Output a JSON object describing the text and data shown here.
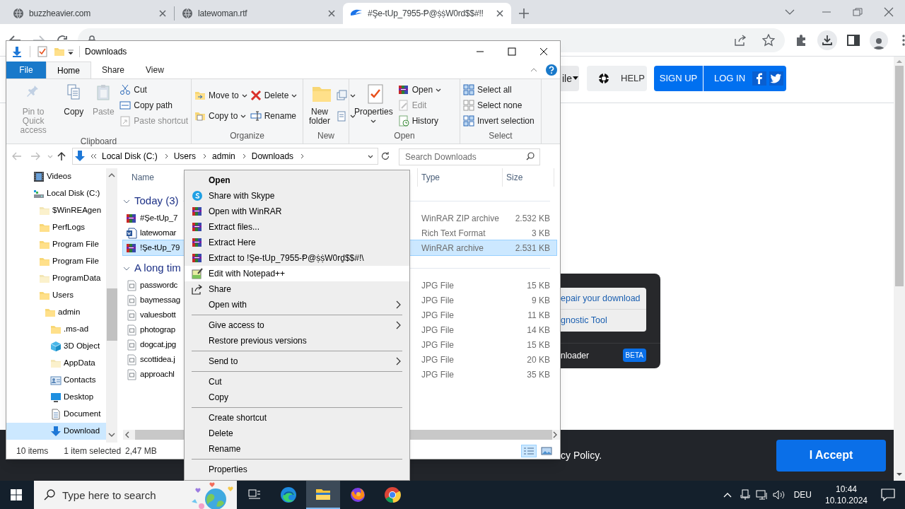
{
  "browser": {
    "tabs": [
      {
        "title": "buzzheavier.com",
        "selected": false
      },
      {
        "title": "latewoman.rtf",
        "selected": false
      },
      {
        "title": "#Şe-tUp_7955-Ᵽ@ṩṩW0rd$$#!!",
        "selected": true
      }
    ],
    "header_buttons": [
      {
        "label": "ile",
        "kind": "menu"
      },
      {
        "label": "HELP",
        "kind": "help"
      }
    ],
    "auth": {
      "sign_up": "SIGN UP",
      "log_in": "LOG IN"
    },
    "download_panel": {
      "links": [
        "epair your download",
        "gnostic Tool"
      ],
      "footer": "nloader",
      "badge": "BETA"
    },
    "cookie_bar": {
      "text": "cy Policy.",
      "button": "I Accept"
    }
  },
  "explorer": {
    "title": "Downloads",
    "ribbon_tabs": [
      {
        "label": "File",
        "selected": false,
        "kind": "file"
      },
      {
        "label": "Home",
        "selected": true,
        "kind": "tab"
      },
      {
        "label": "Share",
        "selected": false,
        "kind": "tab"
      },
      {
        "label": "View",
        "selected": false,
        "kind": "tab"
      }
    ],
    "ribbon_groups": [
      {
        "label": "Clipboard",
        "columns": [
          [
            {
              "label": "Pin to Quick access",
              "kind": "large",
              "disabled": true,
              "dropdown": false
            }
          ],
          [
            {
              "label": "Copy",
              "kind": "large",
              "disabled": false,
              "dropdown": false
            }
          ],
          [
            {
              "label": "Paste",
              "kind": "large",
              "disabled": true,
              "dropdown": false
            }
          ],
          [
            {
              "label": "Cut",
              "kind": "small",
              "disabled": false,
              "dropdown": false
            },
            {
              "label": "Copy path",
              "kind": "small",
              "disabled": false,
              "dropdown": false
            },
            {
              "label": "Paste shortcut",
              "kind": "small",
              "disabled": true,
              "dropdown": false
            }
          ]
        ]
      },
      {
        "label": "Organize",
        "columns": [
          [
            {
              "label": "Move to",
              "kind": "small",
              "disabled": false,
              "dropdown": true
            },
            {
              "label": "Copy to",
              "kind": "small",
              "disabled": false,
              "dropdown": true
            }
          ],
          [
            {
              "label": "Delete",
              "kind": "small",
              "disabled": false,
              "dropdown": true
            },
            {
              "label": "Rename",
              "kind": "small",
              "disabled": false,
              "dropdown": false
            }
          ]
        ]
      },
      {
        "label": "New",
        "columns": [
          [
            {
              "label": "New folder",
              "kind": "large",
              "disabled": false,
              "dropdown": false
            }
          ],
          [
            {
              "kind": "small",
              "disabled": false,
              "dropdown": true
            },
            {
              "kind": "small",
              "disabled": false,
              "dropdown": true
            }
          ]
        ]
      },
      {
        "label": "Open",
        "columns": [
          [
            {
              "label": "Properties",
              "kind": "large",
              "disabled": false,
              "dropdown": true
            }
          ],
          [
            {
              "label": "Open",
              "kind": "small",
              "disabled": false,
              "dropdown": true
            },
            {
              "label": "Edit",
              "kind": "small",
              "disabled": true,
              "dropdown": false
            },
            {
              "label": "History",
              "kind": "small",
              "disabled": false,
              "dropdown": false
            }
          ]
        ]
      },
      {
        "label": "Select",
        "columns": [
          [
            {
              "label": "Select all",
              "kind": "small",
              "disabled": false,
              "dropdown": false
            },
            {
              "label": "Select none",
              "kind": "small",
              "disabled": false,
              "dropdown": false
            },
            {
              "label": "Invert selection",
              "kind": "small",
              "disabled": false,
              "dropdown": false
            }
          ]
        ]
      }
    ],
    "path": [
      "Local Disk (C:)",
      "Users",
      "admin",
      "Downloads"
    ],
    "search_placeholder": "Search Downloads",
    "nav_tree": [
      {
        "label": "Videos",
        "selected": false
      },
      {
        "label": "Local Disk (C:)",
        "selected": false,
        "children": [
          {
            "label": "$WinREAgen",
            "selected": false
          },
          {
            "label": "PerfLogs",
            "selected": false
          },
          {
            "label": "Program File",
            "selected": false
          },
          {
            "label": "Program File",
            "selected": false
          },
          {
            "label": "ProgramData",
            "selected": false
          },
          {
            "label": "Users",
            "selected": false,
            "children": [
              {
                "label": "admin",
                "selected": false,
                "children": [
                  {
                    "label": ".ms-ad",
                    "selected": false
                  },
                  {
                    "label": "3D Object",
                    "selected": false
                  },
                  {
                    "label": "AppData",
                    "selected": false
                  },
                  {
                    "label": "Contacts",
                    "selected": false
                  },
                  {
                    "label": "Desktop",
                    "selected": false
                  },
                  {
                    "label": "Document",
                    "selected": false
                  },
                  {
                    "label": "Download",
                    "selected": true
                  }
                ]
              }
            ]
          }
        ]
      }
    ],
    "columns": [
      "Name",
      "Type",
      "Size"
    ],
    "file_groups": [
      {
        "label": "Today (3)",
        "expanded": true,
        "files": [
          {
            "name": "#Şe-tUp_7",
            "type": "WinRAR ZIP archive",
            "size": "2.532 KB",
            "kind": "archive",
            "selected": false
          },
          {
            "name": "latewomar",
            "type": "Rich Text Format",
            "size": "3 KB",
            "kind": "document",
            "selected": false
          },
          {
            "name": "!Şe-tUp_79",
            "type": "WinRAR archive",
            "size": "2.531 KB",
            "kind": "archive",
            "selected": true
          }
        ]
      },
      {
        "label": "A long tim",
        "expanded": true,
        "files": [
          {
            "name": "passwordc",
            "type": "JPG File",
            "size": "15 KB",
            "kind": "image",
            "selected": false
          },
          {
            "name": "baymessag",
            "type": "JPG File",
            "size": "9 KB",
            "kind": "image",
            "selected": false
          },
          {
            "name": "valuesbott",
            "type": "JPG File",
            "size": "11 KB",
            "kind": "image",
            "selected": false
          },
          {
            "name": "photograp",
            "type": "JPG File",
            "size": "14 KB",
            "kind": "image",
            "selected": false
          },
          {
            "name": "dogcat.jpg",
            "type": "JPG File",
            "size": "15 KB",
            "kind": "image",
            "selected": false
          },
          {
            "name": "scottidea.j",
            "type": "JPG File",
            "size": "20 KB",
            "kind": "image",
            "selected": false
          },
          {
            "name": "approachl",
            "type": "JPG File",
            "size": "35 KB",
            "kind": "image",
            "selected": false
          }
        ]
      }
    ],
    "status": {
      "count": "10 items",
      "selection": "1 item selected",
      "size": "2,47 MB"
    },
    "view_buttons": [
      {
        "selected": true
      },
      {
        "selected": false
      }
    ]
  },
  "context_menu": [
    {
      "kind": "item",
      "label": "Open",
      "default": true,
      "submenu": false,
      "selected": false
    },
    {
      "kind": "item",
      "label": "Share with Skype",
      "default": false,
      "submenu": false,
      "selected": false
    },
    {
      "kind": "item",
      "label": "Open with WinRAR",
      "default": false,
      "submenu": false,
      "selected": false
    },
    {
      "kind": "item",
      "label": "Extract files...",
      "default": false,
      "submenu": false,
      "selected": false
    },
    {
      "kind": "item",
      "label": "Extract Here",
      "default": false,
      "submenu": false,
      "selected": false
    },
    {
      "kind": "item",
      "label": "Extract to !Şe-tUp_7955-Ᵽ@ṩṩW0rḏ$$#!\\",
      "default": false,
      "submenu": false,
      "selected": false
    },
    {
      "kind": "item",
      "label": "Edit with Notepad++",
      "default": false,
      "submenu": false,
      "selected": true
    },
    {
      "kind": "item",
      "label": "Share",
      "default": false,
      "submenu": false,
      "selected": false
    },
    {
      "kind": "item",
      "label": "Open with",
      "default": false,
      "submenu": true,
      "selected": false
    },
    {
      "kind": "separator"
    },
    {
      "kind": "item",
      "label": "Give access to",
      "default": false,
      "submenu": true,
      "selected": false
    },
    {
      "kind": "item",
      "label": "Restore previous versions",
      "default": false,
      "submenu": false,
      "selected": false
    },
    {
      "kind": "separator"
    },
    {
      "kind": "item",
      "label": "Send to",
      "default": false,
      "submenu": true,
      "selected": false
    },
    {
      "kind": "separator"
    },
    {
      "kind": "item",
      "label": "Cut",
      "default": false,
      "submenu": false,
      "selected": false
    },
    {
      "kind": "item",
      "label": "Copy",
      "default": false,
      "submenu": false,
      "selected": false
    },
    {
      "kind": "separator"
    },
    {
      "kind": "item",
      "label": "Create shortcut",
      "default": false,
      "submenu": false,
      "selected": false
    },
    {
      "kind": "item",
      "label": "Delete",
      "default": false,
      "submenu": false,
      "selected": false
    },
    {
      "kind": "item",
      "label": "Rename",
      "default": false,
      "submenu": false,
      "selected": false
    },
    {
      "kind": "separator"
    },
    {
      "kind": "item",
      "label": "Properties",
      "default": false,
      "submenu": false,
      "selected": false
    }
  ],
  "taskbar": {
    "search_placeholder": "Type here to search",
    "apps": [
      {
        "selected": false
      },
      {
        "selected": true
      },
      {
        "selected": false
      },
      {
        "selected": false
      }
    ],
    "language": "DEU",
    "time": "10:44",
    "date": "10.10.2024"
  }
}
